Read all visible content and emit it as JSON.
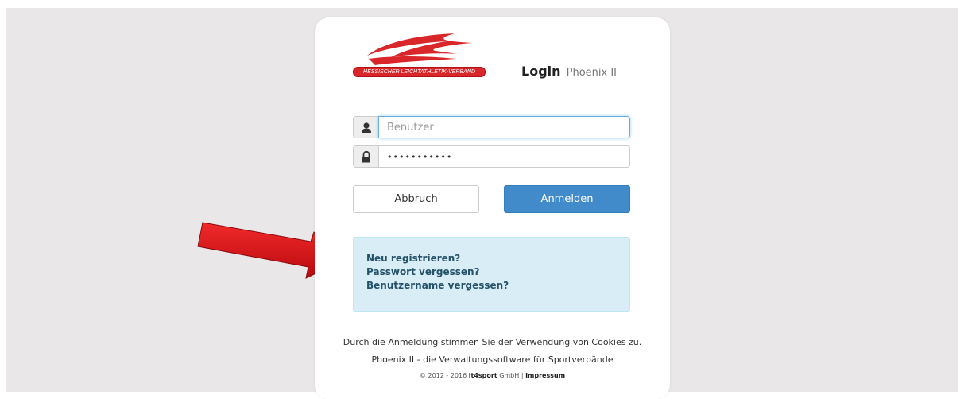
{
  "logo": {
    "org_name": "HESSISCHER LEICHTATHLETIK-VERBAND",
    "brand_color": "#d9262a"
  },
  "header": {
    "title": "Login",
    "subtitle": "Phoenix II"
  },
  "form": {
    "username": {
      "placeholder": "Benutzer",
      "value": "",
      "icon": "user-icon"
    },
    "password": {
      "value": "•••••••••••",
      "icon": "lock-icon"
    },
    "cancel_label": "Abbruch",
    "login_label": "Anmelden",
    "accent_color": "#428bca"
  },
  "links": {
    "register": "Neu registrieren?",
    "forgot_password": "Passwort vergessen?",
    "forgot_username": "Benutzername vergessen?"
  },
  "footer": {
    "cookie_notice": "Durch die Anmeldung stimmen Sie der Verwendung von Cookies zu.",
    "tagline": "Phoenix II - die Verwaltungssoftware für Sportverbände",
    "copyright_prefix": "© 2012 - 2016",
    "company_bold": "it4sport",
    "company_suffix": "GmbH |",
    "impressum": "Impressum"
  },
  "annotation": {
    "arrow_color": "#e8141b",
    "icon": "red-arrow-icon"
  }
}
